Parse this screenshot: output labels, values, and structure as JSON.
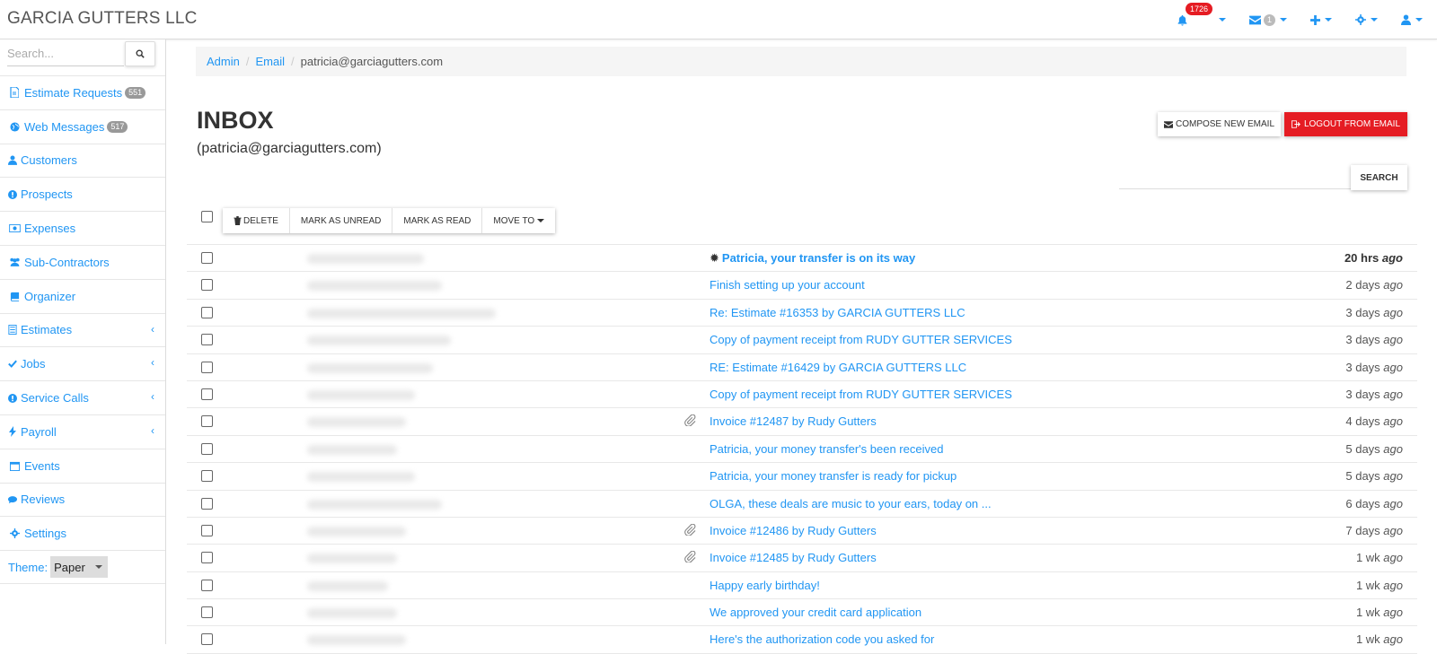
{
  "app": {
    "brand": "GARCIA GUTTERS LLC"
  },
  "nav": {
    "notifications_count": "1726",
    "messages_count": "1"
  },
  "sidebar": {
    "search_placeholder": "Search...",
    "items": [
      {
        "label": "Estimate Requests",
        "count": "551",
        "icon": "file-icon"
      },
      {
        "label": "Web Messages",
        "count": "517",
        "icon": "globe-icon"
      },
      {
        "label": "Customers",
        "icon": "user-icon"
      },
      {
        "label": "Prospects",
        "icon": "info-icon"
      },
      {
        "label": "Expenses",
        "icon": "money-icon"
      },
      {
        "label": "Sub-Contractors",
        "icon": "users-icon"
      },
      {
        "label": "Organizer",
        "icon": "book-icon"
      },
      {
        "label": "Estimates",
        "icon": "list-icon"
      },
      {
        "label": "Jobs",
        "icon": "check-icon"
      },
      {
        "label": "Service Calls",
        "icon": "alert-icon"
      },
      {
        "label": "Payroll",
        "icon": "bolt-icon"
      },
      {
        "label": "Events",
        "icon": "calendar-icon"
      },
      {
        "label": "Reviews",
        "icon": "comment-icon"
      },
      {
        "label": "Settings",
        "icon": "gear-icon"
      }
    ],
    "theme_label": "Theme:",
    "theme_value": "Paper"
  },
  "breadcrumb": {
    "admin": "Admin",
    "email": "Email",
    "current": "patricia@garciagutters.com"
  },
  "header": {
    "title": "INBOX",
    "subtitle": "(patricia@garciagutters.com)",
    "compose_label": "COMPOSE NEW EMAIL",
    "logout_label": "LOGOUT FROM EMAIL",
    "search_label": "SEARCH"
  },
  "toolbar": {
    "delete_label": "DELETE",
    "mark_unread_label": "MARK AS UNREAD",
    "mark_read_label": "MARK AS READ",
    "move_to_label": "MOVE TO"
  },
  "emails": [
    {
      "subject": "Patricia, your transfer is on its way",
      "time": "20 hrs",
      "unread": true,
      "attachment": false,
      "star": true
    },
    {
      "subject": "Finish setting up your account",
      "time": "2 days",
      "unread": false,
      "attachment": false
    },
    {
      "subject": "Re: Estimate #16353 by GARCIA GUTTERS LLC",
      "time": "3 days",
      "unread": false,
      "attachment": false
    },
    {
      "subject": "Copy of payment receipt from RUDY GUTTER SERVICES",
      "time": "3 days",
      "unread": false,
      "attachment": false
    },
    {
      "subject": "RE: Estimate #16429 by GARCIA GUTTERS LLC",
      "time": "3 days",
      "unread": false,
      "attachment": false
    },
    {
      "subject": "Copy of payment receipt from RUDY GUTTER SERVICES",
      "time": "3 days",
      "unread": false,
      "attachment": false
    },
    {
      "subject": "Invoice #12487 by Rudy Gutters",
      "time": "4 days",
      "unread": false,
      "attachment": true
    },
    {
      "subject": "Patricia, your money transfer's been received",
      "time": "5 days",
      "unread": false,
      "attachment": false
    },
    {
      "subject": "Patricia, your money transfer is ready for pickup",
      "time": "5 days",
      "unread": false,
      "attachment": false
    },
    {
      "subject": "OLGA, these deals are music to your ears, today on ...",
      "time": "6 days",
      "unread": false,
      "attachment": false
    },
    {
      "subject": "Invoice #12486 by Rudy Gutters",
      "time": "7 days",
      "unread": false,
      "attachment": true
    },
    {
      "subject": "Invoice #12485 by Rudy Gutters",
      "time": "1 wk",
      "unread": false,
      "attachment": true
    },
    {
      "subject": "Happy early birthday!",
      "time": "1 wk",
      "unread": false,
      "attachment": false
    },
    {
      "subject": "We approved your credit card application",
      "time": "1 wk",
      "unread": false,
      "attachment": false
    },
    {
      "subject": "Here's the authorization code you asked for",
      "time": "1 wk",
      "unread": false,
      "attachment": false
    }
  ],
  "time_suffix": "ago",
  "colors": {
    "accent": "#2196f3",
    "danger": "#e51c23",
    "text": "#333333"
  }
}
